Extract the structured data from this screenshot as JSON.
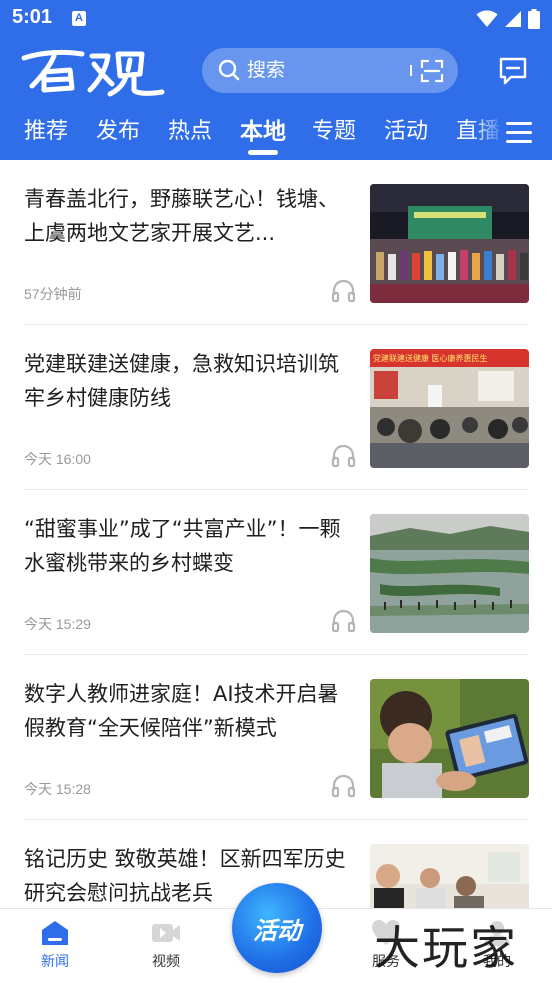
{
  "status_bar": {
    "time": "5:01",
    "notif_letter": "A"
  },
  "header": {
    "logo_text": "百观",
    "search_placeholder": "搜索"
  },
  "tabs": [
    {
      "label": "推荐",
      "active": false
    },
    {
      "label": "发布",
      "active": false
    },
    {
      "label": "热点",
      "active": false
    },
    {
      "label": "本地",
      "active": true
    },
    {
      "label": "专题",
      "active": false
    },
    {
      "label": "活动",
      "active": false
    },
    {
      "label": "直播",
      "active": false
    }
  ],
  "news": [
    {
      "title": "青春盖北行，野藤联艺心！钱塘、上虞两地文艺家开展文艺...",
      "time": "57分钟前"
    },
    {
      "title": "党建联建送健康，急救知识培训筑牢乡村健康防线",
      "time": "今天 16:00",
      "thumb_banner": "党建联建送健康 医心康养惠民生"
    },
    {
      "title": "“甜蜜事业”成了“共富产业”！一颗水蜜桃带来的乡村蝶变",
      "time": "今天 15:29"
    },
    {
      "title": "数字人教师进家庭！AI技术开启暑假教育“全天候陪伴”新模式",
      "time": "今天 15:28"
    },
    {
      "title": "铭记历史 致敬英雄！区新四军历史研究会慰问抗战老兵",
      "time": ""
    }
  ],
  "bottom_nav": {
    "items": [
      {
        "label": "新闻",
        "icon": "news-icon",
        "active": true
      },
      {
        "label": "视频",
        "icon": "video-icon",
        "active": false
      },
      {
        "label": "服务",
        "icon": "heart-icon",
        "active": false
      },
      {
        "label": "我的",
        "icon": "profile-icon",
        "active": false
      }
    ],
    "center_label": "活动"
  },
  "watermark": "大玩家",
  "colors": {
    "brand_blue": "#2f6ee8",
    "title_text": "#1f1f1f",
    "meta_text": "#999999"
  }
}
